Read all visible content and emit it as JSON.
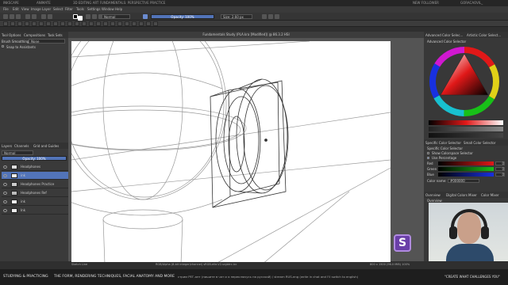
{
  "top_strip": {
    "items": [
      "INKSCAPE",
      "ANIMATE",
      "3D EDITING ART FUNDAMENTALS: PERSPECTIVE PRACTICE",
      "NEW FOLLOWER",
      "GORACAOVIL_"
    ]
  },
  "menu": {
    "items": [
      "File",
      "Edit",
      "View",
      "Image",
      "Layer",
      "Select",
      "Filter",
      "Tools",
      "Settings",
      "Window",
      "Help"
    ]
  },
  "tool_options": {
    "blend_mode": "Normal",
    "opacity_label": "Opacity: 100%",
    "size_label": "Size: 2.60 px"
  },
  "left_panel": {
    "tabs": [
      "Tool Options",
      "Compositions",
      "Task Sets"
    ],
    "brush_smoothing_label": "Brush Smoothing:",
    "brush_smoothing_value": "None",
    "snap_label": "Snap to Assistants",
    "layer_tabs": [
      "Layers",
      "Channels",
      "Grid and Guides"
    ],
    "layer_blend": "Normal",
    "layer_opacity": "Opacity: 100%",
    "layers": [
      "Headphones",
      "ink",
      "Headphones Practice",
      "Headphones Ref",
      "ink",
      "Ink"
    ]
  },
  "canvas": {
    "title": "Fundamentals Study (PLA.kra [Modified]) @ 86.3.2 HSI"
  },
  "right_panel": {
    "tabs": [
      "Advanced Color Selec...",
      "Artistic Color Select..."
    ],
    "panel_title": "Advanced Color Selector",
    "specific_tabs": [
      "Specific Color Selector",
      "Small Color Selector"
    ],
    "specific_title": "Specific Color Selector",
    "show_colorspace": "Show Colorspace Selector",
    "use_percentage": "Use Percentage",
    "sliders": [
      {
        "label": "Red",
        "value": "0"
      },
      {
        "label": "Green",
        "value": "0"
      },
      {
        "label": "Blue",
        "value": "0"
      }
    ],
    "color_name_label": "Color name:",
    "color_name_value": "#000000",
    "bottom_tabs": [
      "Overview",
      "Digital Colors Mixer",
      "Color Mixer"
    ],
    "overview_label": "Overview",
    "colors": {
      "red": "#e01818",
      "green": "#18c018",
      "blue": "#1830e0"
    }
  },
  "status": {
    "left": "Sketch Line",
    "center": "RGB/Alpha (8-bit integer/channel) sRGB-elle-V2-srgbtrc.icc",
    "right": "800 x 1500 (96.0 MiB) 100%"
  },
  "bottom": {
    "items": [
      "STUDYING & PRACTICING",
      "THE FORM, RENDERING TECHNIQUES, FACIAL ANATOMY AND MORE",
      "стрим РЕГ-ант (пишите в чат и я переключусь на русский) / stream RUS-eng (write in chat and I'll switch to english)",
      "\"CREATE WHAT CHALLENGES YOU\""
    ]
  }
}
